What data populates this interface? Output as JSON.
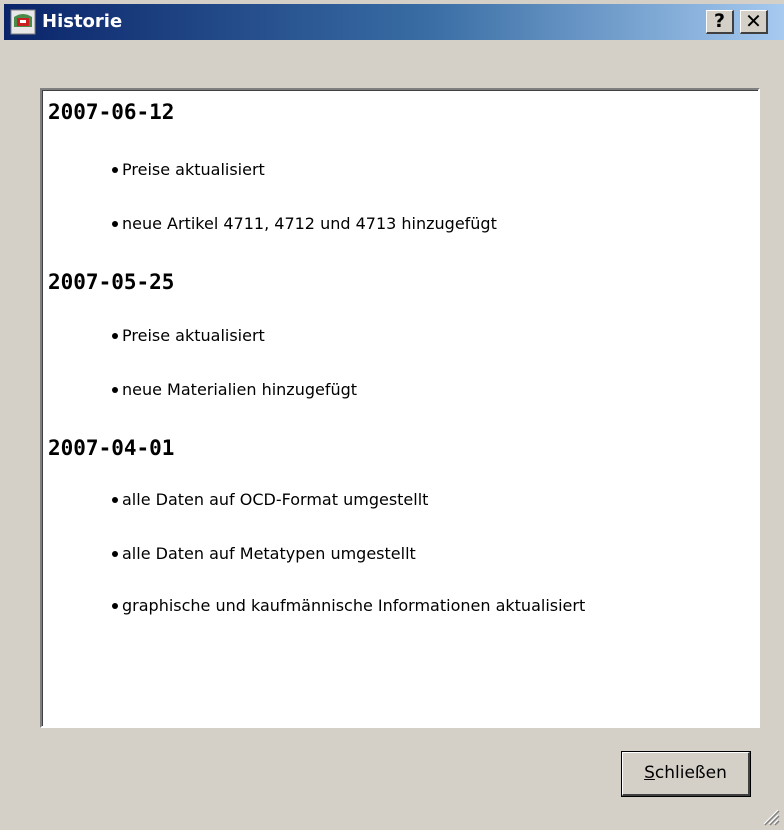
{
  "window": {
    "title": "Historie",
    "help_label": "?",
    "close_label": "✕"
  },
  "history": [
    {
      "date": "2007-06-12",
      "items": [
        "Preise aktualisiert",
        "neue Artikel 4711, 4712 und 4713 hinzugefügt"
      ]
    },
    {
      "date": "2007-05-25",
      "items": [
        "Preise aktualisiert",
        "neue Materialien hinzugefügt"
      ]
    },
    {
      "date": "2007-04-01",
      "items": [
        "alle Daten auf OCD-Format umgestellt",
        "alle Daten auf Metatypen umgestellt",
        "graphische und kaufmännische Informationen aktualisiert"
      ]
    }
  ],
  "footer": {
    "close_button_mnemonic": "S",
    "close_button_rest": "chließen"
  },
  "icons": {
    "app": "app-logo-icon",
    "help": "help-icon",
    "close": "close-icon",
    "grip": "resize-grip-icon"
  }
}
